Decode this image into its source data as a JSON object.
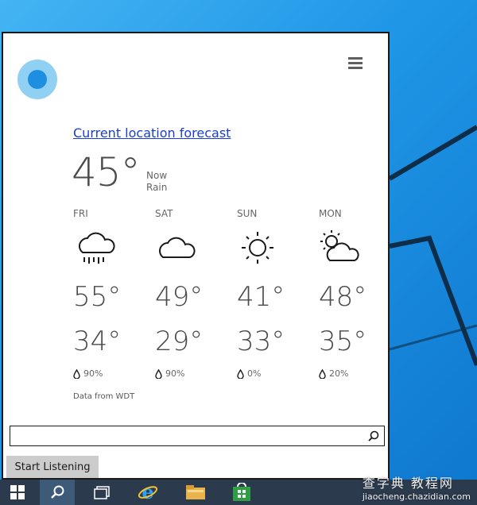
{
  "window": {
    "forecast_link": "Current location forecast",
    "current": {
      "temp": "45°",
      "label_now": "Now",
      "condition": "Rain"
    },
    "days": [
      {
        "name": "FRI",
        "icon": "rain-cloud-icon",
        "high": "55°",
        "low": "34°",
        "precip": "90%"
      },
      {
        "name": "SAT",
        "icon": "cloud-icon",
        "high": "49°",
        "low": "29°",
        "precip": "90%"
      },
      {
        "name": "SUN",
        "icon": "sun-icon",
        "high": "41°",
        "low": "33°",
        "precip": "0%"
      },
      {
        "name": "MON",
        "icon": "partly-cloudy-icon",
        "high": "48°",
        "low": "35°",
        "precip": "20%"
      }
    ],
    "data_source": "Data from WDT",
    "search": {
      "placeholder": ""
    },
    "listen_button": "Start Listening"
  },
  "watermark": {
    "line1": "查字典 教程网",
    "line2": "jiaocheng.chazidian.com"
  },
  "taskbar": {
    "items": [
      "start-icon",
      "search-icon",
      "task-view-icon",
      "internet-explorer-icon",
      "file-explorer-icon",
      "store-icon"
    ]
  },
  "colors": {
    "accent": "#1e8fe0",
    "link": "#1a3fd0",
    "taskbar": "#2b3a4c"
  }
}
